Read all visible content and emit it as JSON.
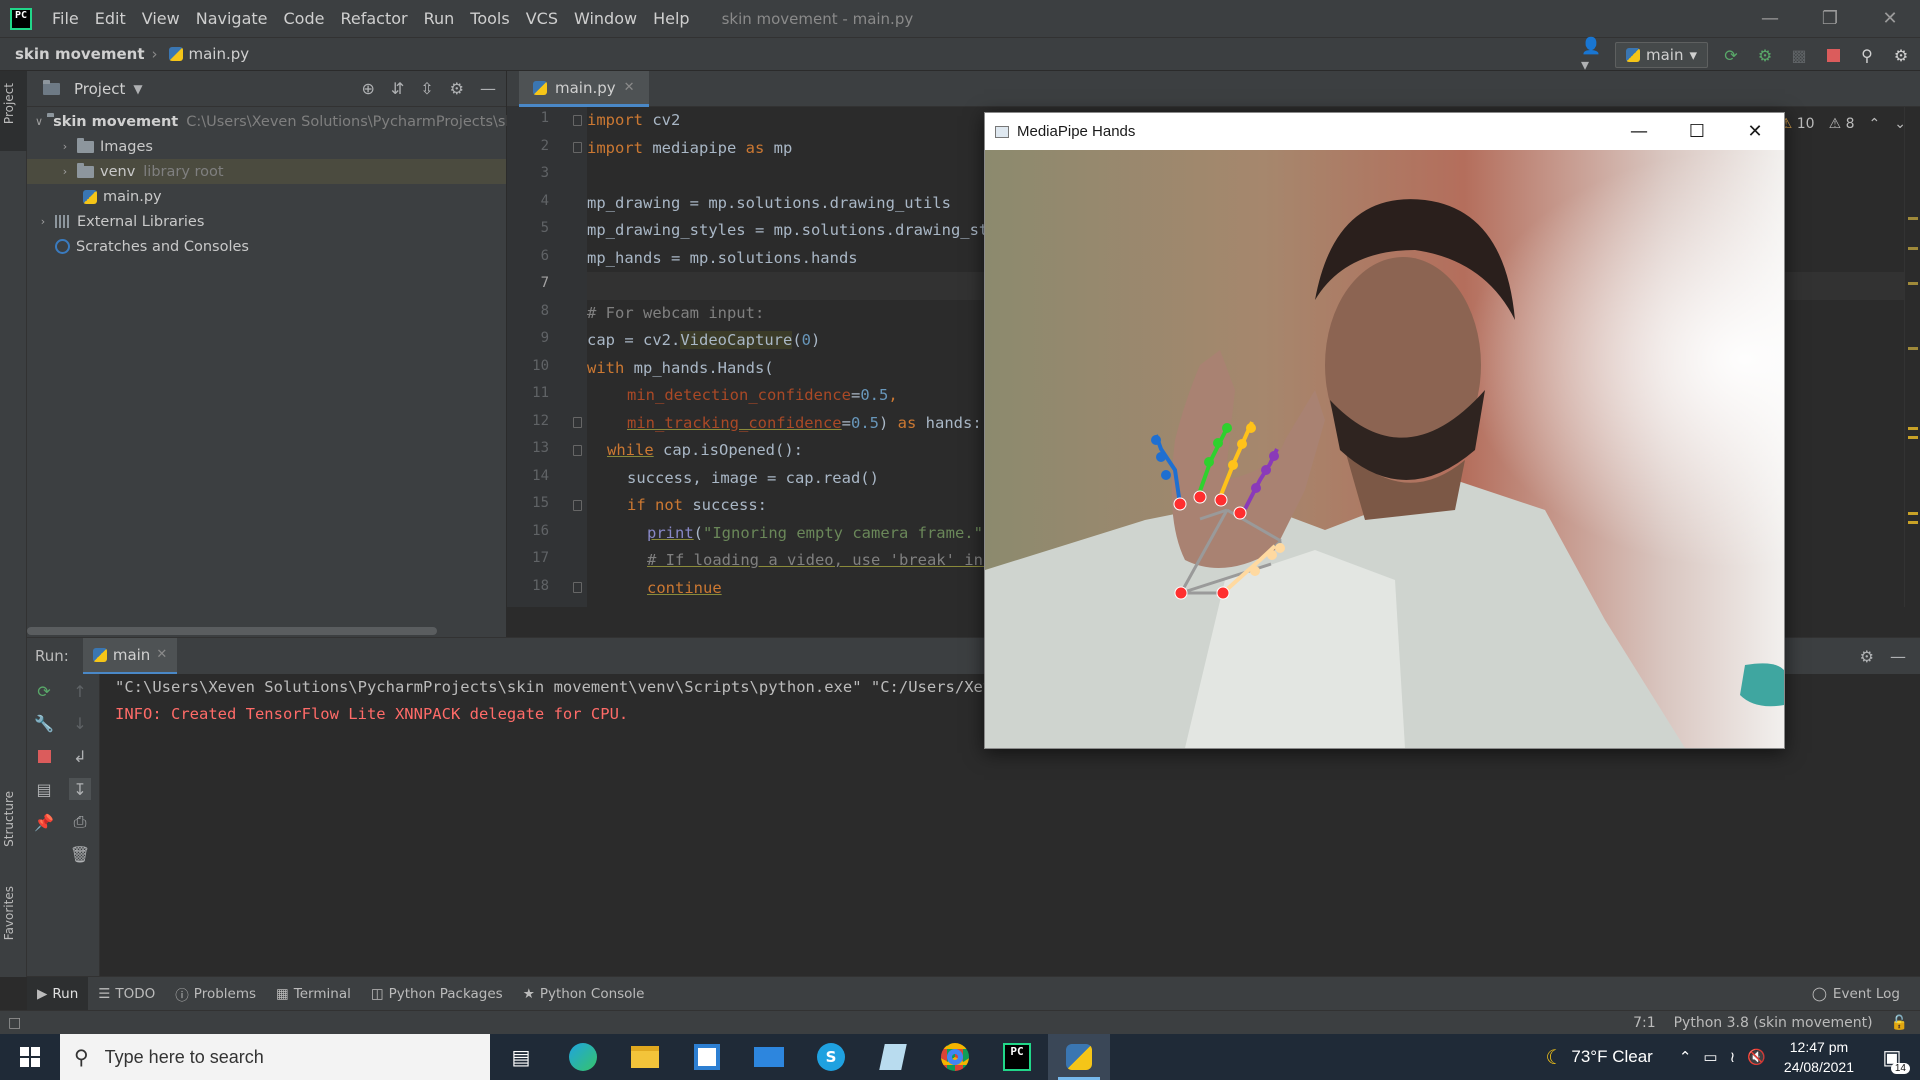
{
  "titlebar": {
    "menu": [
      "File",
      "Edit",
      "View",
      "Navigate",
      "Code",
      "Refactor",
      "Run",
      "Tools",
      "VCS",
      "Window",
      "Help"
    ],
    "window_title": "skin movement - main.py"
  },
  "navbar": {
    "project": "skin movement",
    "file": "main.py",
    "run_config": "main"
  },
  "left_strip": {
    "project_tab": "Project",
    "structure_tab": "Structure",
    "favorites_tab": "Favorites"
  },
  "project_pane": {
    "title": "Project",
    "tree": {
      "root_name": "skin movement",
      "root_path": "C:\\Users\\Xeven Solutions\\PycharmProjects\\skin",
      "images": "Images",
      "venv": "venv",
      "venv_note": "library root",
      "main": "main.py",
      "external": "External Libraries",
      "scratches": "Scratches and Consoles"
    }
  },
  "editor": {
    "tab": "main.py",
    "warnings_count": "10",
    "weak_warnings_count": "8",
    "line_numbers": [
      "1",
      "2",
      "3",
      "4",
      "5",
      "6",
      "7",
      "8",
      "9",
      "10",
      "11",
      "12",
      "13",
      "14",
      "15",
      "16",
      "17",
      "18"
    ],
    "code": {
      "l1_kw": "import",
      "l1_rest": " cv2",
      "l2_kw": "import",
      "l2_mid": " mediapipe ",
      "l2_as": "as",
      "l2_rest": " mp",
      "l4": "mp_drawing = mp.solutions.drawing_utils",
      "l5": "mp_drawing_styles = mp.solutions.drawing_styles",
      "l6": "mp_hands = mp.solutions.hands",
      "l8": "# For webcam input:",
      "l9_a": "cap = cv2.",
      "l9_fn": "VideoCapture",
      "l9_p1": "(",
      "l9_num": "0",
      "l9_p2": ")",
      "l10_kw": "with",
      "l10_rest": " mp_hands.Hands(",
      "l11_param": "min_detection_confidence",
      "l11_eq": "=",
      "l11_num": "0.5",
      "l11_comma": ",",
      "l12_param": "min_tracking_confidence",
      "l12_eq": "=",
      "l12_num": "0.5",
      "l12_p": ") ",
      "l12_as": "as",
      "l12_rest": " hands:",
      "l13_kw": "while",
      "l13_rest": " cap.isOpened():",
      "l14": "success, image = cap.read()",
      "l15_kw": "if not",
      "l15_rest": " success:",
      "l16_fn": "print",
      "l16_p": "(",
      "l16_str": "\"Ignoring empty camera frame.\"",
      "l17": "# If loading a video, use 'break' instead of 'continue'.",
      "l18_kw": "continue"
    }
  },
  "run": {
    "label": "Run:",
    "tab": "main",
    "console_cmd": "\"C:\\Users\\Xeven Solutions\\PycharmProjects\\skin movement\\venv\\Scripts\\python.exe\" \"C:/Users/Xeven Solutions/PycharmProjects/skin movement/main.py\"",
    "console_info": "INFO: Created TensorFlow Lite XNNPACK delegate for CPU."
  },
  "bottom_tools": {
    "run": "Run",
    "todo": "TODO",
    "problems": "Problems",
    "terminal": "Terminal",
    "packages": "Python Packages",
    "console": "Python Console",
    "event_log": "Event Log"
  },
  "status": {
    "position": "7:1",
    "interpreter": "Python 3.8 (skin movement)"
  },
  "mediapipe_window": {
    "title": "MediaPipe Hands"
  },
  "taskbar": {
    "search_placeholder": "Type here to search",
    "weather": "73°F  Clear",
    "time": "12:47 pm",
    "date": "24/08/2021",
    "notifications": "14"
  },
  "colors": {
    "accent": "#4a88c7",
    "landmark_red": "#ff2f2f",
    "thumb": "#1f6fd1",
    "index": "#2ed12e",
    "middle": "#ffc21a",
    "ring": "#ffd21f",
    "pinky": "#8a3ab9"
  }
}
